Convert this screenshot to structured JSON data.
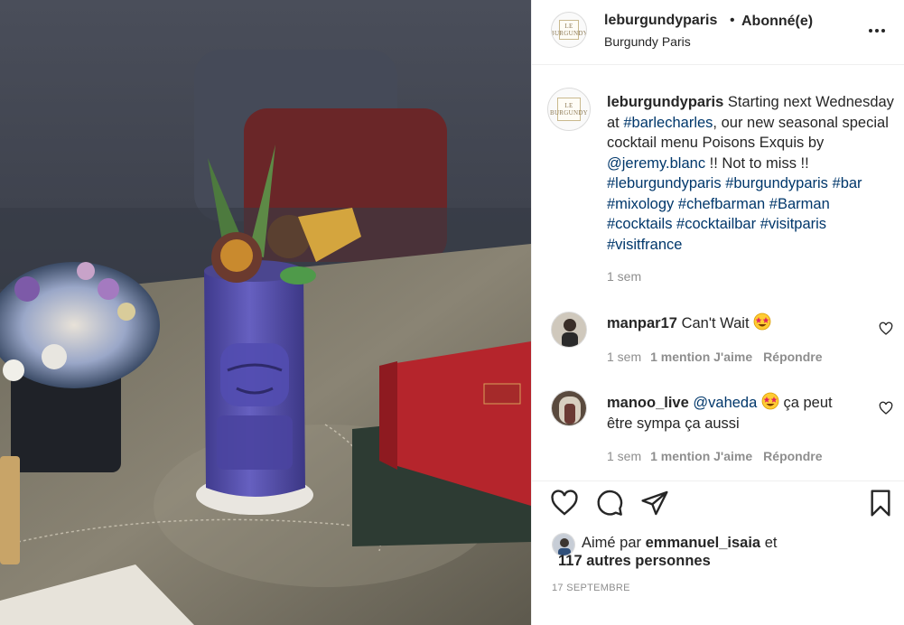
{
  "post": {
    "username": "leburgundyparis",
    "separator": "•",
    "follow_label": "Abonné(e)",
    "location": "Burgundy Paris",
    "logo_text": "LE BURGUNDY",
    "more_icon": "more-horizontal-icon"
  },
  "caption": {
    "username": "leburgundyparis",
    "text_1": "Starting next Wednesday at",
    "tag_1": "#barlecharles",
    "text_2": ", our new seasonal special cocktail menu Poisons Exquis by",
    "mention": "@jeremy.blanc",
    "text_3": "!! Not to miss !!",
    "hashtags": [
      "#leburgundyparis",
      "#burgundyparis",
      "#bar",
      "#mixology",
      "#chefbarman",
      "#Barman",
      "#cocktails",
      "#cocktailbar",
      "#visitparis",
      "#visitfrance"
    ],
    "time": "1 sem"
  },
  "comments": [
    {
      "username": "manpar17",
      "text": "Can't Wait",
      "emoji": "star-struck",
      "time": "1 sem",
      "likes": "1 mention J'aime",
      "reply": "Répondre"
    },
    {
      "username": "manoo_live",
      "mention": "@vaheda",
      "emoji": "star-struck",
      "text": "ça peut être sympa ça aussi",
      "time": "1 sem",
      "likes": "1 mention J'aime",
      "reply": "Répondre"
    }
  ],
  "actions": {
    "icons": [
      "heart-icon",
      "comment-icon",
      "share-icon",
      "bookmark-icon"
    ]
  },
  "likes": {
    "prefix": "Aimé par",
    "user": "emmanuel_isaia",
    "conj": "et",
    "others": "117 autres personnes"
  },
  "date": "17 SEPTEMBRE",
  "colors": {
    "link": "#00376b",
    "muted": "#8e8e8e",
    "text": "#262626",
    "border": "#efefef",
    "cup": "#5b56b0"
  }
}
